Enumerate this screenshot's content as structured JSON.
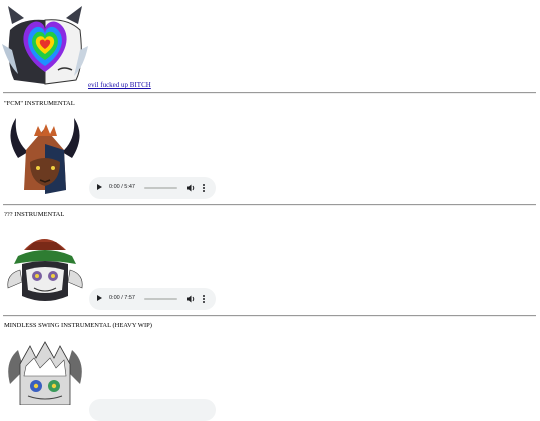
{
  "header": {
    "link_text": "evil fucked up BITCH"
  },
  "tracks": [
    {
      "title": "\"FCM\" INSTRUMENTAL",
      "time": "0:00 / 5:47"
    },
    {
      "title": "??? INSTRUMENTAL",
      "time": "0:00 / 7:57"
    },
    {
      "title": "MINDLESS SWING INSTRUMENTAL (HEAVY WIP)",
      "time": ""
    }
  ],
  "icons": [
    "play-icon",
    "volume-icon",
    "more-options-icon"
  ]
}
